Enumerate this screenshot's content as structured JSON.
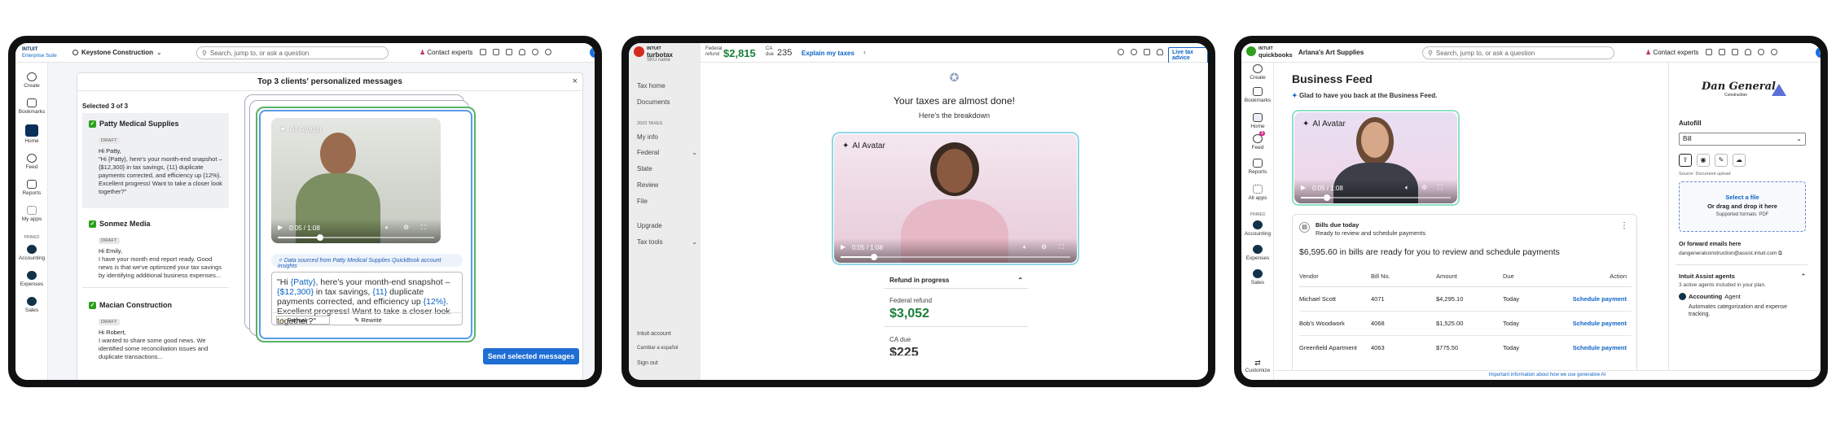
{
  "s1": {
    "logo_top": "INTUIT",
    "logo_bottom": "Enterprise Suite",
    "company": "Keystone Construction",
    "search_placeholder": "Search, jump to, or ask a question",
    "contact": "Contact experts",
    "avatar": "J",
    "nav": [
      {
        "label": "Create"
      },
      {
        "label": "Bookmarks"
      },
      {
        "label": "Home"
      },
      {
        "label": "Feed"
      },
      {
        "label": "Reports"
      },
      {
        "label": "My apps"
      }
    ],
    "pinned": "PINNED",
    "pinned_items": [
      {
        "label": "Accounting"
      },
      {
        "label": "Expenses"
      },
      {
        "label": "Sales"
      }
    ],
    "modal_title": "Top 3 clients' personalized messages",
    "selected": "Selected 3 of 3",
    "draft_label": "DRAFT",
    "clients": [
      {
        "name": "Patty Medical Supplies",
        "greeting": "Hi Patty,",
        "body": "\"Hi {Patty}, here's your month-end snapshot – {$12,300} in tax savings, {11} duplicate payments corrected, and efficiency up {12%}. Excellent progress! Want to take a closer look together?\""
      },
      {
        "name": "Sonmez Media",
        "greeting": "Hi Emily,",
        "body": "I have your month end report ready. Good news is that we've optimized your tax savings by identifying additional business expenses..."
      },
      {
        "name": "Macian Construction",
        "greeting": "Hi Robert,",
        "body": "I wanted to share some good news. We identified some reconciliation issues and duplicate transactions..."
      }
    ],
    "avatar_tag": "AI Avatar",
    "video_time": "0:05 / 1:08",
    "source_note": "Data sourced from Patty Medical Supplies QuickBook account insights",
    "message_parts": [
      "\"Hi ",
      "{Patty}",
      ", here's your month-end snapshot – ",
      "{$12,300}",
      " in tax savings, ",
      "{11}",
      " duplicate payments corrected, and efficiency up ",
      "{12%}",
      ". Excellent progress! Want to take a closer look together?\""
    ],
    "tone": "Formal",
    "rewrite": "Rewrite",
    "send_button": "Send selected messages (3)"
  },
  "s2": {
    "logo_top": "INTUIT",
    "logo_bottom": "turbotax",
    "sku": "SKU name",
    "fed_label_1": "Federal",
    "fed_label_2": "refund",
    "fed_value": "$2,815",
    "ca_label_1": "CA",
    "ca_label_2": "due",
    "ca_value": "235",
    "explain": "Explain my taxes",
    "live": "Live tax advice",
    "side_items": [
      {
        "label": "Tax home"
      },
      {
        "label": "Documents"
      }
    ],
    "year_header": "2023 TAXES",
    "year_items": [
      {
        "label": "My info"
      },
      {
        "label": "Federal"
      },
      {
        "label": "State"
      },
      {
        "label": "Review"
      },
      {
        "label": "File"
      }
    ],
    "bottom_items": [
      {
        "label": "Upgrade"
      },
      {
        "label": "Tax tools"
      }
    ],
    "footer_items": [
      {
        "label": "Intuit account"
      },
      {
        "label": "Cambiar a español"
      },
      {
        "label": "Sign out"
      }
    ],
    "headline": "Your taxes are almost done!",
    "sub": "Here's the breakdown",
    "avatar_tag": "AI Avatar",
    "video_time": "0:05 / 1:08",
    "panel_title": "Refund in progress",
    "fed_refund_label": "Federal refund",
    "fed_refund_value": "$3,052",
    "ca_due_label": "CA due",
    "ca_due_value": "$225"
  },
  "s3": {
    "logo_top": "INTUIT",
    "logo_bottom": "quickbooks",
    "company": "Arlana's Art Supplies",
    "search_placeholder": "Search, jump to, or ask a question",
    "contact": "Contact experts",
    "avatar": "J",
    "nav": [
      {
        "label": "Create"
      },
      {
        "label": "Bookmarks"
      },
      {
        "label": "Home"
      },
      {
        "label": "Feed"
      },
      {
        "label": "Reports"
      },
      {
        "label": "All apps"
      }
    ],
    "feed_badge": "3",
    "pinned": "PINNED",
    "pinned_items": [
      {
        "label": "Accounting"
      },
      {
        "label": "Expenses"
      },
      {
        "label": "Sales"
      }
    ],
    "customize": "Customize",
    "title": "Business Feed",
    "welcome": "Glad to have you back at the Business Feed.",
    "avatar_tag": "AI Avatar",
    "video_time": "0:05 / 1:08",
    "bills_title": "Bills due today",
    "bills_sub": "Ready to review and schedule payments",
    "bills_summary": "$6,595.60 in bills are ready for you to review and schedule payments",
    "headers": [
      "Vendor",
      "Bill No.",
      "Amount",
      "Due",
      "Action"
    ],
    "rows": [
      {
        "vendor": "Michael Scott",
        "bill": "4071",
        "amount": "$4,295.10",
        "due": "Today",
        "action": "Schedule payment"
      },
      {
        "vendor": "Bob's Woodwork",
        "bill": "4068",
        "amount": "$1,525.00",
        "due": "Today",
        "action": "Schedule payment"
      },
      {
        "vendor": "Greenfield Apartment",
        "bill": "4063",
        "amount": "$775.50",
        "due": "Today",
        "action": "Schedule payment"
      }
    ],
    "logo_name_1": "Dan General",
    "logo_name_2": "Construction",
    "autofill": "Autofill",
    "doc_type": "Bill",
    "source_note": "Source: Document upload",
    "select_file": "Select a file",
    "drop": "Or drag and drop it here",
    "formats": "Supported formats: PDF",
    "forward": "Or forward emails here",
    "email": "dangeneralconstruction@assist.intuit.com",
    "agents_title": "Intuit Assist agents",
    "agents_sub": "3 active agents included in your plan.",
    "agent_name": "Accounting",
    "agent_suffix": "Agent",
    "agent_desc": "Automates categorization and expense tracking.",
    "footer": "Important information about how we use generative AI"
  }
}
